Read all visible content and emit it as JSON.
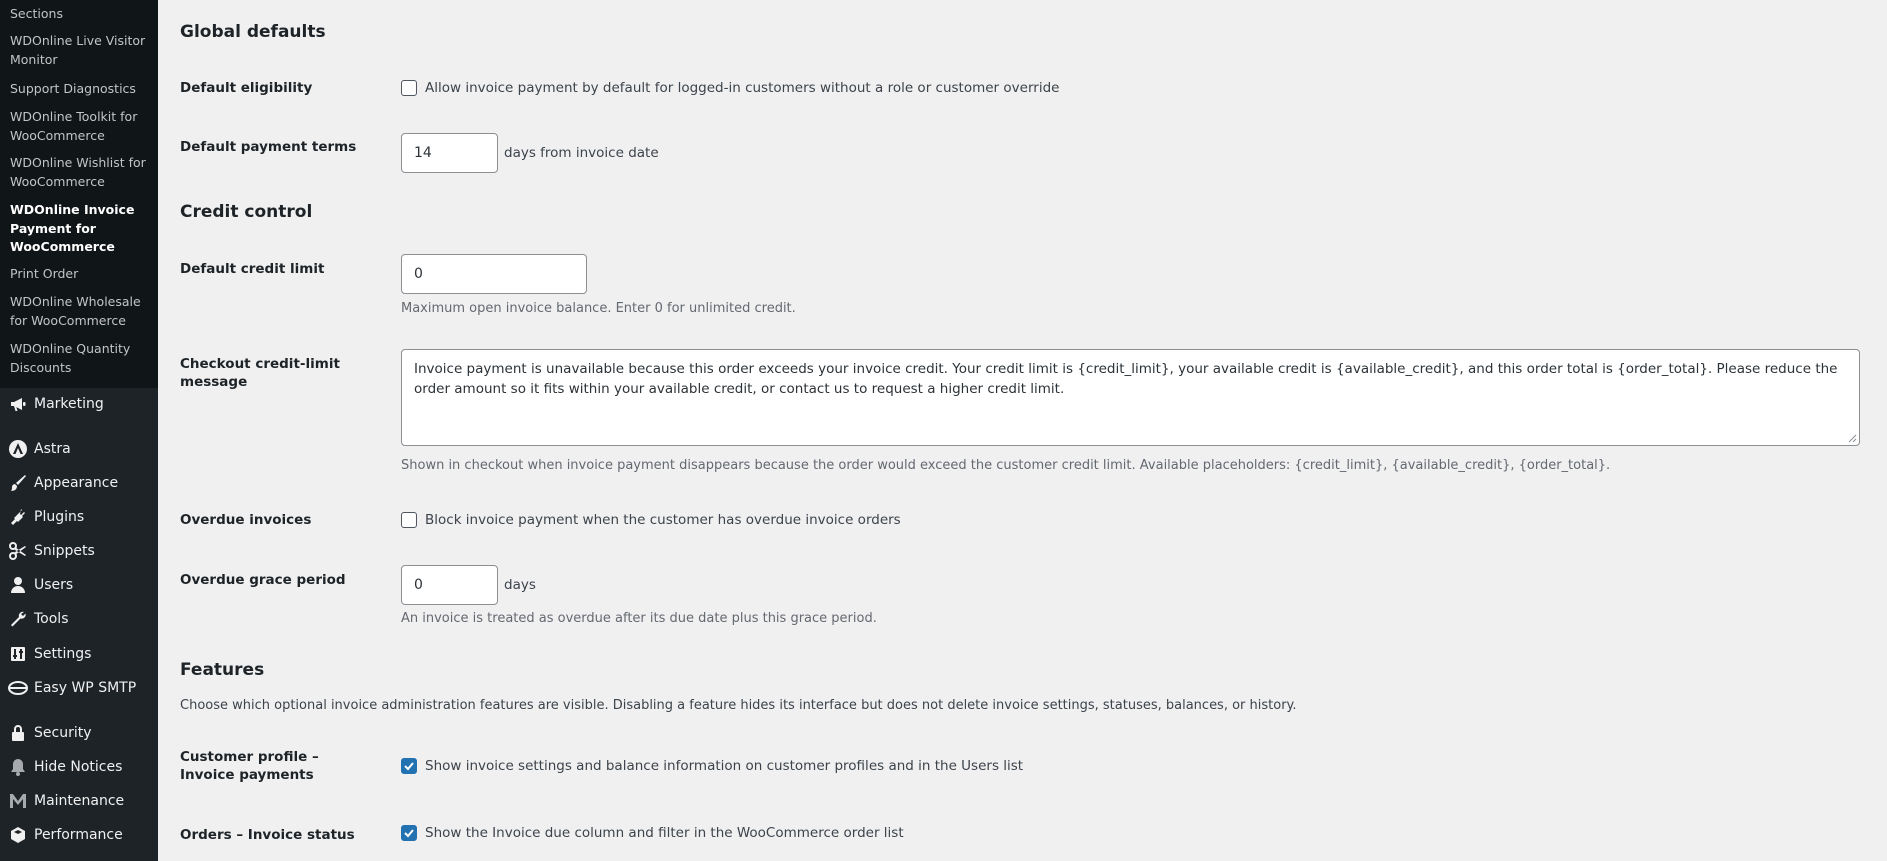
{
  "sidebar": {
    "submenu": [
      {
        "label": "Sections"
      },
      {
        "label": "WDOnline Live Visitor Monitor"
      },
      {
        "label": "Support Diagnostics"
      },
      {
        "label": "WDOnline Toolkit for WooCommerce"
      },
      {
        "label": "WDOnline Wishlist for WooCommerce"
      },
      {
        "label": "WDOnline Invoice Payment for WooCommerce",
        "current": true
      },
      {
        "label": "Print Order"
      },
      {
        "label": "WDOnline Wholesale for WooCommerce"
      },
      {
        "label": "WDOnline Quantity Discounts"
      }
    ],
    "menu": [
      {
        "label": "Marketing",
        "icon": "megaphone-icon"
      },
      {
        "label": "Astra",
        "icon": "astra-icon"
      },
      {
        "label": "Appearance",
        "icon": "paintbrush-icon"
      },
      {
        "label": "Plugins",
        "icon": "plug-icon"
      },
      {
        "label": "Snippets",
        "icon": "scissors-icon"
      },
      {
        "label": "Users",
        "icon": "user-icon"
      },
      {
        "label": "Tools",
        "icon": "wrench-icon"
      },
      {
        "label": "Settings",
        "icon": "settings-icon"
      },
      {
        "label": "Easy WP SMTP",
        "icon": "smtp-icon"
      },
      {
        "label": "Security",
        "icon": "lock-icon"
      },
      {
        "label": "Hide Notices",
        "icon": "bell-icon"
      },
      {
        "label": "Maintenance",
        "icon": "maintenance-icon"
      },
      {
        "label": "Performance",
        "icon": "performance-icon"
      }
    ]
  },
  "settings": {
    "global_defaults": {
      "title": "Global defaults",
      "eligibility_label": "Default eligibility",
      "eligibility_checkbox": "Allow invoice payment by default for logged-in customers without a role or customer override",
      "eligibility_checked": false,
      "terms_label": "Default payment terms",
      "terms_value": "14",
      "terms_suffix": "days from invoice date"
    },
    "credit_control": {
      "title": "Credit control",
      "limit_label": "Default credit limit",
      "limit_value": "0",
      "limit_desc": "Maximum open invoice balance. Enter 0 for unlimited credit.",
      "message_label": "Checkout credit-limit message",
      "message_value": "Invoice payment is unavailable because this order exceeds your invoice credit. Your credit limit is {credit_limit}, your available credit is {available_credit}, and this order total is {order_total}. Please reduce the order amount so it fits within your available credit, or contact us to request a higher credit limit.",
      "message_desc": "Shown in checkout when invoice payment disappears because the order would exceed the customer credit limit. Available placeholders: {credit_limit}, {available_credit}, {order_total}.",
      "overdue_label": "Overdue invoices",
      "overdue_checkbox": "Block invoice payment when the customer has overdue invoice orders",
      "overdue_checked": false,
      "grace_label": "Overdue grace period",
      "grace_value": "0",
      "grace_suffix": "days",
      "grace_desc": "An invoice is treated as overdue after its due date plus this grace period."
    },
    "features": {
      "title": "Features",
      "desc": "Choose which optional invoice administration features are visible. Disabling a feature hides its interface but does not delete invoice settings, statuses, balances, or history.",
      "profile_label": "Customer profile – Invoice payments",
      "profile_checkbox": "Show invoice settings and balance information on customer profiles and in the Users list",
      "profile_checked": true,
      "orders_label": "Orders – Invoice status",
      "orders_checkbox": "Show the Invoice due column and filter in the WooCommerce order list",
      "orders_checked": true
    }
  },
  "colors": {
    "sidebar_bg": "#1d2327",
    "submenu_bg": "#101517",
    "accent": "#2271b1",
    "page_bg": "#f0f0f1"
  }
}
